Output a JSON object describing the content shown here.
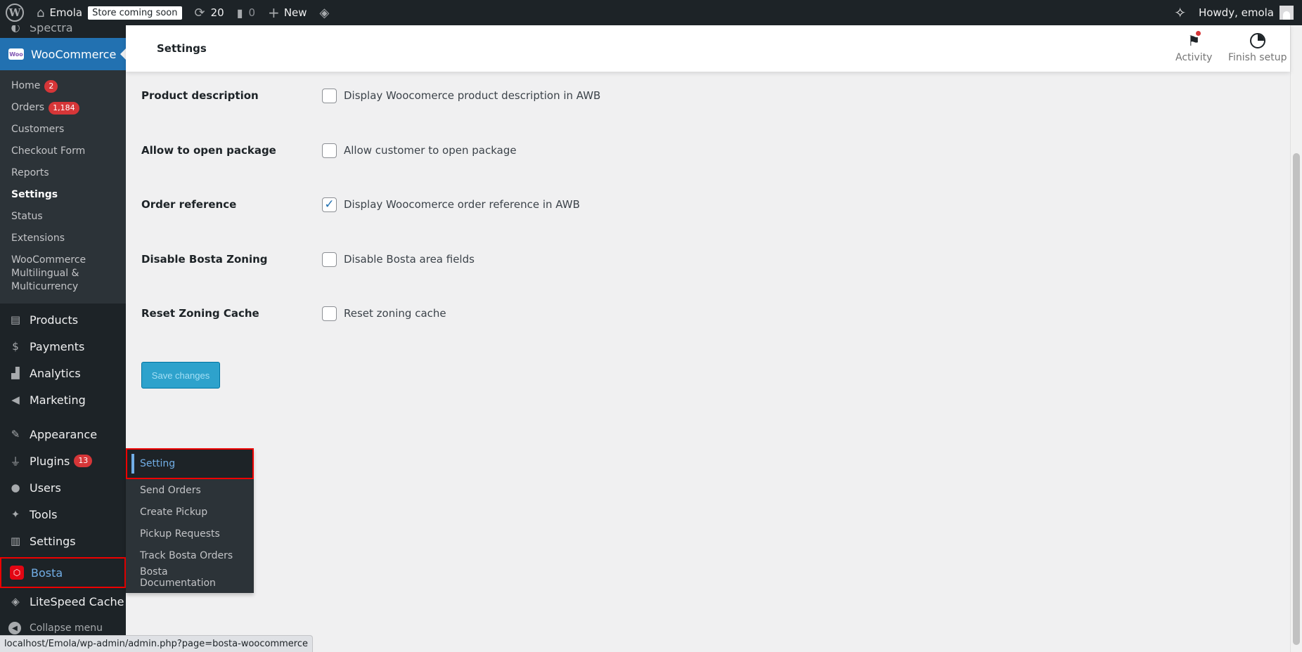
{
  "adminbar": {
    "site_name": "Emola",
    "store_badge": "Store coming soon",
    "updates_count": "20",
    "comments_count": "0",
    "new_label": "New",
    "howdy": "Howdy, emola"
  },
  "sidebar": {
    "partial_item": "Spectra",
    "woocommerce": "WooCommerce",
    "woo_logo": "Woo",
    "woo_submenu": [
      {
        "label": "Home",
        "badge": "2"
      },
      {
        "label": "Orders",
        "badge": "1,184"
      },
      {
        "label": "Customers"
      },
      {
        "label": "Checkout Form"
      },
      {
        "label": "Reports"
      },
      {
        "label": "Settings"
      },
      {
        "label": "Status"
      },
      {
        "label": "Extensions"
      },
      {
        "label": "WooCommerce Multilingual & Multicurrency"
      }
    ],
    "items": [
      {
        "label": "Products",
        "icon": "archive-icon"
      },
      {
        "label": "Payments",
        "icon": "dollar-icon"
      },
      {
        "label": "Analytics",
        "icon": "bar-chart-icon"
      },
      {
        "label": "Marketing",
        "icon": "megaphone-icon"
      },
      {
        "label": "Appearance",
        "icon": "brush-icon"
      },
      {
        "label": "Plugins",
        "icon": "plug-icon",
        "badge": "13"
      },
      {
        "label": "Users",
        "icon": "user-icon"
      },
      {
        "label": "Tools",
        "icon": "wrench-icon"
      },
      {
        "label": "Settings",
        "icon": "sliders-icon"
      },
      {
        "label": "Bosta",
        "icon": "bosta-icon"
      },
      {
        "label": "LiteSpeed Cache",
        "icon": "diamond-icon"
      }
    ],
    "collapse": "Collapse menu"
  },
  "bosta_flyout": [
    "Setting",
    "Send Orders",
    "Create Pickup",
    "Pickup Requests",
    "Track Bosta Orders",
    "Bosta Documentation"
  ],
  "header": {
    "title": "Settings",
    "activity": "Activity",
    "finish_setup": "Finish setup"
  },
  "form": {
    "rows": [
      {
        "label": "Product description",
        "desc": "Display Woocomerce product description in AWB",
        "checked": false
      },
      {
        "label": "Allow to open package",
        "desc": "Allow customer to open package",
        "checked": false
      },
      {
        "label": "Order reference",
        "desc": "Display Woocomerce order reference in AWB",
        "checked": true
      },
      {
        "label": "Disable Bosta Zoning",
        "desc": "Disable Bosta area fields",
        "checked": false
      },
      {
        "label": "Reset Zoning Cache",
        "desc": "Reset zoning cache",
        "checked": false
      }
    ],
    "save_label": "Save changes"
  },
  "statusbar": {
    "url": "localhost/Emola/wp-admin/admin.php?page=bosta-woocommerce"
  }
}
